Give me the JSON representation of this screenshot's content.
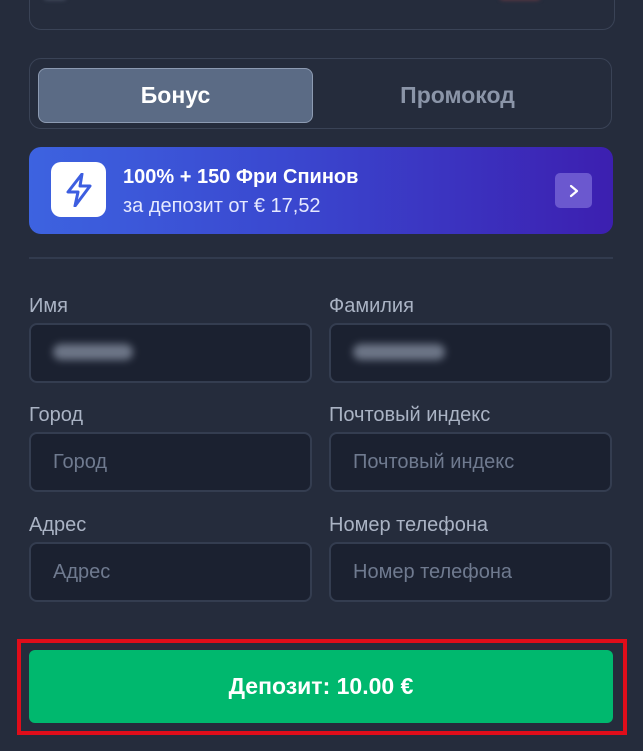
{
  "tabs": [
    {
      "label": "Бонус",
      "active": true
    },
    {
      "label": "Промокод",
      "active": false
    }
  ],
  "bonus_banner": {
    "icon": "lightning-icon",
    "title": "100% + 150 Фри Спинов",
    "subtitle": "за депозит от € 17,52",
    "arrow_icon": "chevron-right-icon"
  },
  "form": {
    "first_name": {
      "label": "Имя",
      "value_obscured": true
    },
    "last_name": {
      "label": "Фамилия",
      "value_obscured": true
    },
    "city": {
      "label": "Город",
      "placeholder": "Город"
    },
    "postal_code": {
      "label": "Почтовый индекс",
      "placeholder": "Почтовый индекс"
    },
    "address": {
      "label": "Адрес",
      "placeholder": "Адрес"
    },
    "phone": {
      "label": "Номер телефона",
      "placeholder": "Номер телефона"
    }
  },
  "deposit_button": {
    "label": "Депозит: 10.00 €",
    "highlighted": true
  },
  "colors": {
    "background": "#252c3c",
    "accent_green": "#00b86e",
    "banner_blue": "#3d63e0",
    "banner_purple": "#3c1fb0",
    "highlight_red": "#e00d1a"
  }
}
